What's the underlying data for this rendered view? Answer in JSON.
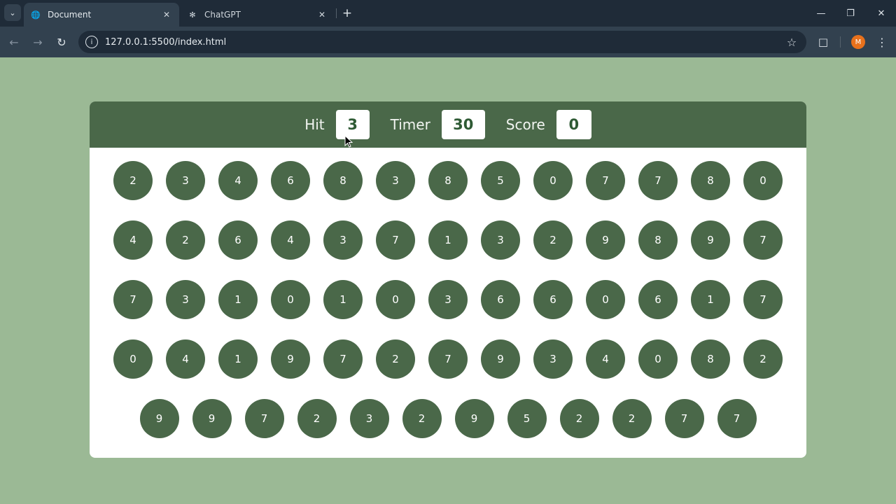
{
  "browser": {
    "tabs": [
      {
        "title": "Document",
        "favicon": "globe-icon",
        "active": true
      },
      {
        "title": "ChatGPT",
        "favicon": "openai-icon",
        "active": false
      }
    ],
    "url": "127.0.0.1:5500/index.html",
    "profile_initial": "M",
    "profile_color": "#e8711c"
  },
  "game": {
    "hit_label": "Hit",
    "hit_value": "3",
    "timer_label": "Timer",
    "timer_value": "30",
    "score_label": "Score",
    "score_value": "0",
    "bubbles": [
      "2",
      "3",
      "4",
      "6",
      "8",
      "3",
      "8",
      "5",
      "0",
      "7",
      "7",
      "8",
      "0",
      "4",
      "2",
      "6",
      "4",
      "3",
      "7",
      "1",
      "3",
      "2",
      "9",
      "8",
      "9",
      "7",
      "7",
      "3",
      "1",
      "0",
      "1",
      "0",
      "3",
      "6",
      "6",
      "0",
      "6",
      "1",
      "7",
      "0",
      "4",
      "1",
      "9",
      "7",
      "2",
      "7",
      "9",
      "3",
      "4",
      "0",
      "8",
      "2",
      "9",
      "9",
      "7",
      "2",
      "3",
      "2",
      "9",
      "5",
      "2",
      "2",
      "7",
      "7"
    ]
  },
  "colors": {
    "page_background": "#9bb995",
    "panel_header": "#4a6849",
    "bubble": "#4a6849",
    "stat_value_text": "#2e5a34"
  }
}
